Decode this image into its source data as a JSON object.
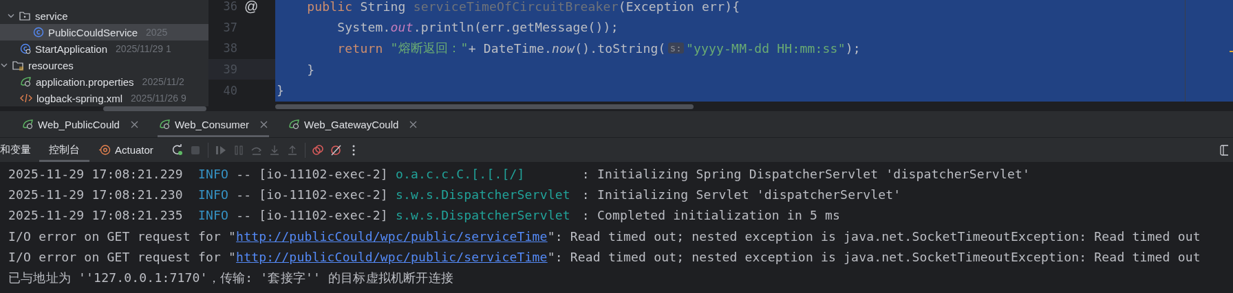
{
  "project_tree": [
    {
      "children": [
        {
          "label": "service",
          "kind": "folder",
          "expanded": true,
          "selected": false,
          "children": [
            {
              "label": "PublicCouldService",
              "date": "2025",
              "kind": "class",
              "selected": true
            }
          ]
        },
        {
          "label": "StartApplication",
          "date": "2025/11/29 1",
          "kind": "app-class",
          "selected": false
        }
      ]
    },
    {
      "label": "resources",
      "kind": "resources-folder",
      "expanded": true,
      "selected": false,
      "children": [
        {
          "label": "application.properties",
          "date": "2025/11/2",
          "kind": "spring-config",
          "selected": false
        },
        {
          "label": "logback-spring.xml",
          "date": "2025/11/26 9",
          "kind": "xml",
          "selected": false
        }
      ]
    }
  ],
  "editor": {
    "lines": [
      {
        "number": "36",
        "current": false,
        "marker": "@",
        "tokens": [
          {
            "kind": "keyword",
            "text": "    public"
          },
          {
            "kind": "plain",
            "text": " String "
          },
          {
            "kind": "unused",
            "text": "serviceTimeOfCircuitBreaker"
          },
          {
            "kind": "plain",
            "text": "(Exception err){"
          }
        ]
      },
      {
        "number": "37",
        "current": false,
        "tokens": [
          {
            "kind": "plain",
            "text": "        System."
          },
          {
            "kind": "field",
            "text": "out"
          },
          {
            "kind": "plain",
            "text": ".println(err.getMessage());"
          }
        ]
      },
      {
        "number": "38",
        "current": false,
        "tokens": [
          {
            "kind": "keyword",
            "text": "        return "
          },
          {
            "kind": "string",
            "text": "\"熔断返回：\""
          },
          {
            "kind": "plain",
            "text": "+ DateTime."
          },
          {
            "kind": "static",
            "text": "now"
          },
          {
            "kind": "plain",
            "text": "().toString("
          },
          {
            "kind": "hint",
            "text": "s:"
          },
          {
            "kind": "string",
            "text": "\"yyyy-MM-dd HH:mm:ss\""
          },
          {
            "kind": "plain",
            "text": ");"
          }
        ]
      },
      {
        "number": "39",
        "current": true,
        "tokens": [
          {
            "kind": "plain",
            "text": "    }"
          }
        ]
      },
      {
        "number": "40",
        "current": false,
        "tokens": [
          {
            "kind": "plain",
            "text": "}"
          }
        ]
      }
    ]
  },
  "run_tabs": [
    {
      "label": "Web_PublicCould",
      "selected": false
    },
    {
      "label": "Web_Consumer",
      "selected": true
    },
    {
      "label": "Web_GatewayCould",
      "selected": false
    }
  ],
  "toolbar": {
    "tabs": [
      {
        "label": "和变量",
        "kind": "text",
        "selected": false
      },
      {
        "label": "控制台",
        "kind": "text",
        "selected": true
      },
      {
        "label": "Actuator",
        "kind": "actuator",
        "selected": false
      }
    ],
    "actions": [
      {
        "kind": "rerun",
        "disabled": false
      },
      {
        "kind": "stop",
        "disabled": true
      },
      {
        "kind": "separator"
      },
      {
        "kind": "resume",
        "disabled": true
      },
      {
        "kind": "pause",
        "disabled": true
      },
      {
        "kind": "step-over",
        "disabled": true
      },
      {
        "kind": "step-into",
        "disabled": true
      },
      {
        "kind": "step-out",
        "disabled": true
      },
      {
        "kind": "separator"
      },
      {
        "kind": "breakpoints",
        "disabled": false
      },
      {
        "kind": "mute",
        "disabled": false
      },
      {
        "kind": "more",
        "disabled": false
      }
    ]
  },
  "console": [
    {
      "kind": "log",
      "timestamp": "2025-11-29 17:08:21.229",
      "level": "INFO",
      "thread": "-- [io-11102-exec-2]",
      "logger": "o.a.c.c.C.[.[.[/]",
      "message": ": Initializing Spring DispatcherServlet 'dispatcherServlet'"
    },
    {
      "kind": "log",
      "timestamp": "2025-11-29 17:08:21.230",
      "level": "INFO",
      "thread": "-- [io-11102-exec-2]",
      "logger": "s.w.s.DispatcherServlet",
      "message": ": Initializing Servlet 'dispatcherServlet'"
    },
    {
      "kind": "log",
      "timestamp": "2025-11-29 17:08:21.235",
      "level": "INFO",
      "thread": "-- [io-11102-exec-2]",
      "logger": "s.w.s.DispatcherServlet",
      "message": ": Completed initialization in 5 ms"
    },
    {
      "kind": "error",
      "before": "I/O error on GET request for \"",
      "url": "http://publicCould/wpc/public/serviceTime",
      "after": "\": Read timed out; nested exception is java.net.SocketTimeoutException: Read timed out"
    },
    {
      "kind": "error",
      "before": "I/O error on GET request for \"",
      "url": "http://publicCould/wpc/public/serviceTime",
      "after": "\": Read timed out; nested exception is java.net.SocketTimeoutException: Read timed out"
    },
    {
      "kind": "system",
      "text": "已与地址为 ''127.0.0.1:7170'，传输: '套接字'' 的目标虚拟机断开连接"
    }
  ]
}
